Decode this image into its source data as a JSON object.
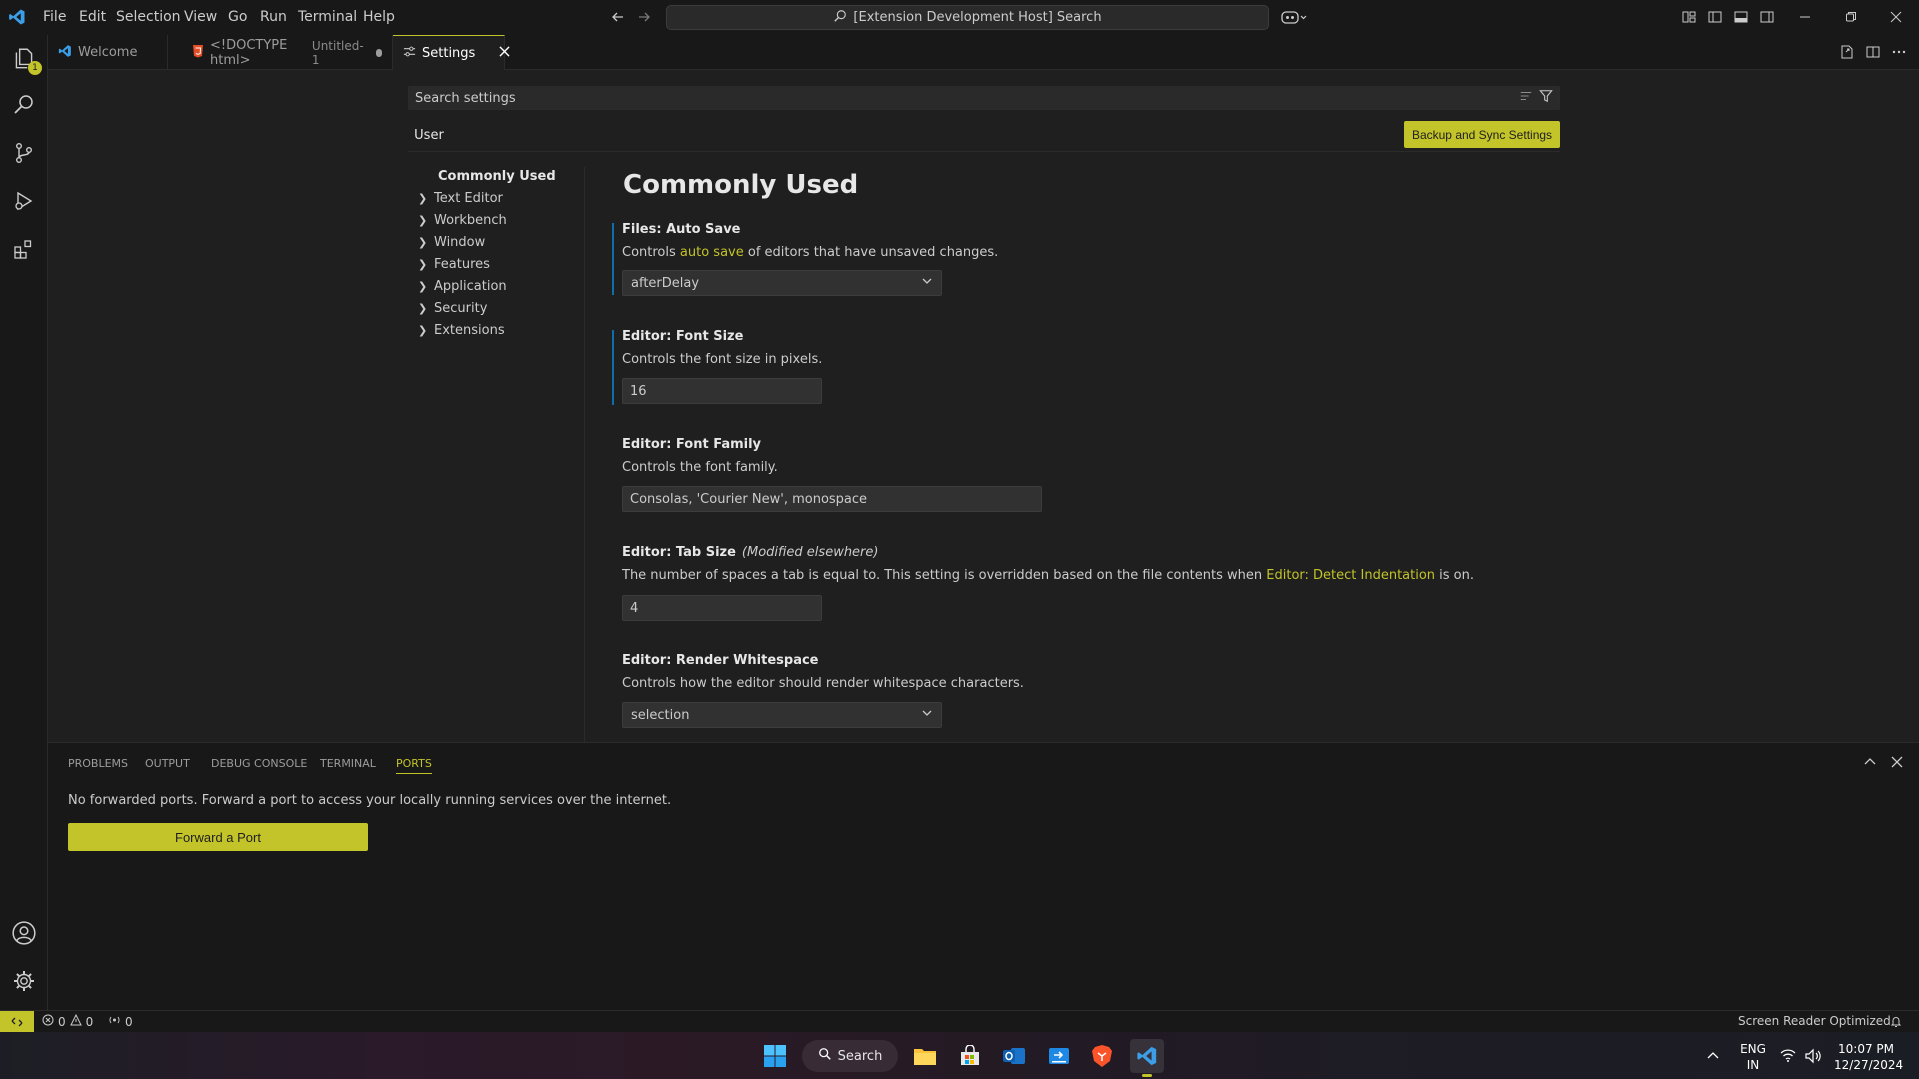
{
  "titlebar": {
    "menu": [
      "File",
      "Edit",
      "Selection",
      "View",
      "Go",
      "Run",
      "Terminal",
      "Help"
    ],
    "command_center": "[Extension Development Host] Search"
  },
  "tabs": [
    {
      "label": "Welcome",
      "description": ""
    },
    {
      "label": "<!DOCTYPE html>",
      "description": "Untitled-1"
    },
    {
      "label": "Settings",
      "description": ""
    }
  ],
  "activity_badge": "1",
  "settings": {
    "search_placeholder": "Search settings",
    "scope_tab": "User",
    "sync_button": "Backup and Sync Settings",
    "toc": {
      "active": "Commonly Used",
      "items": [
        "Text Editor",
        "Workbench",
        "Window",
        "Features",
        "Application",
        "Security",
        "Extensions"
      ]
    },
    "page_title": "Commonly Used",
    "items": [
      {
        "title": "Files: Auto Save",
        "desc_before": "Controls ",
        "desc_link": "auto save",
        "desc_after": " of editors that have unsaved changes.",
        "value": "afterDelay"
      },
      {
        "title": "Editor: Font Size",
        "description": "Controls the font size in pixels.",
        "value": "16"
      },
      {
        "title": "Editor: Font Family",
        "description": "Controls the font family.",
        "value": "Consolas, 'Courier New', monospace"
      },
      {
        "title": "Editor: Tab Size",
        "modifier": "(Modified elsewhere)",
        "desc_before": "The number of spaces a tab is equal to. This setting is overridden based on the file contents when ",
        "desc_link": "Editor: Detect Indentation",
        "desc_after": " is on.",
        "value": "4"
      },
      {
        "title": "Editor: Render Whitespace",
        "description": "Controls how the editor should render whitespace characters.",
        "value": "selection"
      }
    ]
  },
  "panel": {
    "tabs": [
      "PROBLEMS",
      "OUTPUT",
      "DEBUG CONSOLE",
      "TERMINAL",
      "PORTS"
    ],
    "active_tab": "PORTS",
    "message": "No forwarded ports. Forward a port to access your locally running services over the internet.",
    "button": "Forward a Port"
  },
  "statusbar": {
    "errors": "0",
    "warnings": "0",
    "ports": "0",
    "screen_reader": "Screen Reader Optimized"
  },
  "taskbar": {
    "search": "Search",
    "lang_line1": "ENG",
    "lang_line2": "IN",
    "time": "10:07 PM",
    "date": "12/27/2024"
  },
  "colors": {
    "accent": "#c3c32a",
    "background": "#1f1f1f",
    "modified_indicator": "#0e6eab"
  }
}
